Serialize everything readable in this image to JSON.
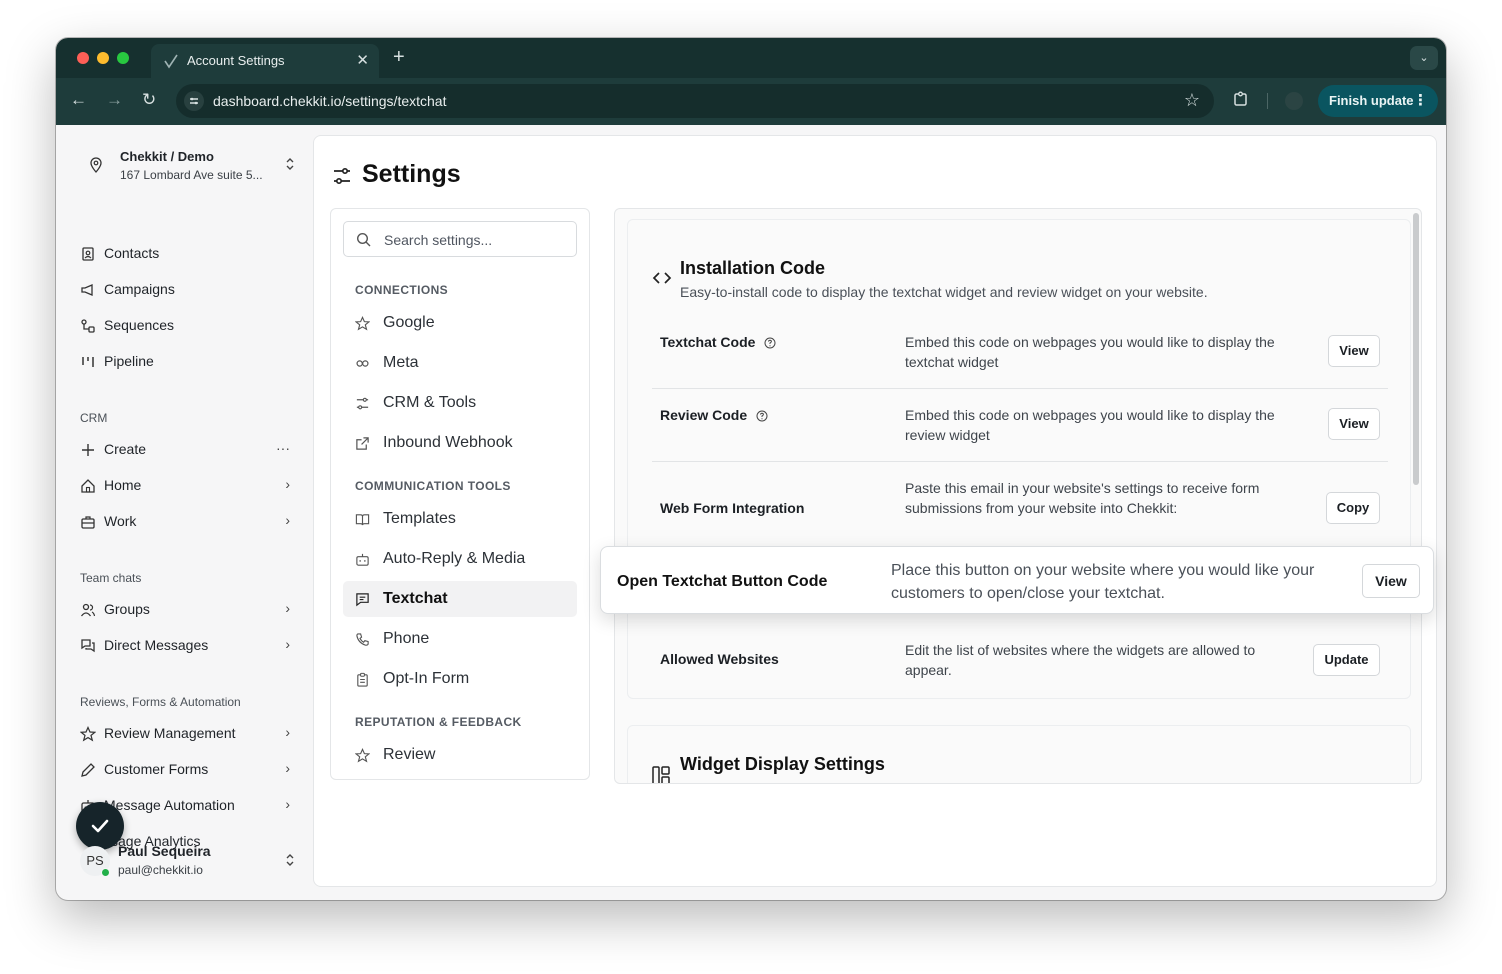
{
  "browser": {
    "tab_title": "Account Settings",
    "tab_close": "✕",
    "new_tab": "+",
    "tab_menu": "⌄",
    "url": "dashboard.chekkit.io/settings/textchat",
    "back": "←",
    "forward": "→",
    "reload": "↻",
    "bookmark": "☆",
    "finish_update": "Finish update",
    "menu_dots": "⋮"
  },
  "sidebar": {
    "location_name": "Chekkit / Demo",
    "location_address": "167 Lombard Ave suite 5...",
    "updown": "⌃⌄",
    "items_top": [
      {
        "label": "Contacts",
        "icon": "contacts-icon"
      },
      {
        "label": "Campaigns",
        "icon": "megaphone-icon"
      },
      {
        "label": "Sequences",
        "icon": "sequences-icon"
      },
      {
        "label": "Pipeline",
        "icon": "pipeline-icon"
      }
    ],
    "crm_heading": "CRM",
    "crm_items": [
      {
        "label": "Create",
        "icon": "plus-icon",
        "trailing": "···"
      },
      {
        "label": "Home",
        "icon": "home-icon",
        "trailing": "›"
      },
      {
        "label": "Work",
        "icon": "briefcase-icon",
        "trailing": "›"
      }
    ],
    "team_heading": "Team chats",
    "team_items": [
      {
        "label": "Groups",
        "icon": "users-icon",
        "trailing": "›"
      },
      {
        "label": "Direct Messages",
        "icon": "messages-icon",
        "trailing": "›"
      }
    ],
    "reviews_heading": "Reviews, Forms & Automation",
    "reviews_items": [
      {
        "label": "Review Management",
        "icon": "star-icon",
        "trailing": "›"
      },
      {
        "label": "Customer Forms",
        "icon": "pencil-icon",
        "trailing": "›"
      },
      {
        "label": "Message Automation",
        "icon": "bot-icon",
        "trailing": "›"
      },
      {
        "label": "ssage Analytics",
        "icon": "chart-icon",
        "trailing": ""
      }
    ],
    "user": {
      "initials": "PS",
      "name": "Paul Sequeira",
      "email": "paul@chekkit.io"
    }
  },
  "page": {
    "title": "Settings"
  },
  "settings_nav": {
    "search_placeholder": "Search settings...",
    "sections": [
      {
        "heading": "CONNECTIONS",
        "items": [
          "Google",
          "Meta",
          "CRM & Tools",
          "Inbound Webhook"
        ]
      },
      {
        "heading": "COMMUNICATION TOOLS",
        "items": [
          "Templates",
          "Auto-Reply & Media",
          "Textchat",
          "Phone",
          "Opt-In Form"
        ]
      },
      {
        "heading": "REPUTATION & FEEDBACK",
        "items": [
          "Review"
        ]
      }
    ],
    "active": "Textchat"
  },
  "installation": {
    "title": "Installation Code",
    "subtitle": "Easy-to-install code to display the textchat widget and review widget on your website.",
    "rows": [
      {
        "label": "Textchat Code",
        "description": "Embed this code on webpages you would like to display the textchat widget",
        "button": "View"
      },
      {
        "label": "Review Code",
        "description": "Embed this code on webpages you would like to display the review widget",
        "button": "View"
      },
      {
        "label": "Web Form Integration",
        "description": "Paste this email in your website's settings to receive form submissions from your website into Chekkit:",
        "button": "Copy"
      },
      {
        "label": "Allowed Websites",
        "description": "Edit the list of websites where the widgets are allowed to appear.",
        "button": "Update"
      }
    ]
  },
  "floating_row": {
    "label": "Open Textchat Button Code",
    "description": "Place this button on your website where you would like your customers to open/close your textchat.",
    "button": "View"
  },
  "widget_display": {
    "title": "Widget Display Settings"
  }
}
